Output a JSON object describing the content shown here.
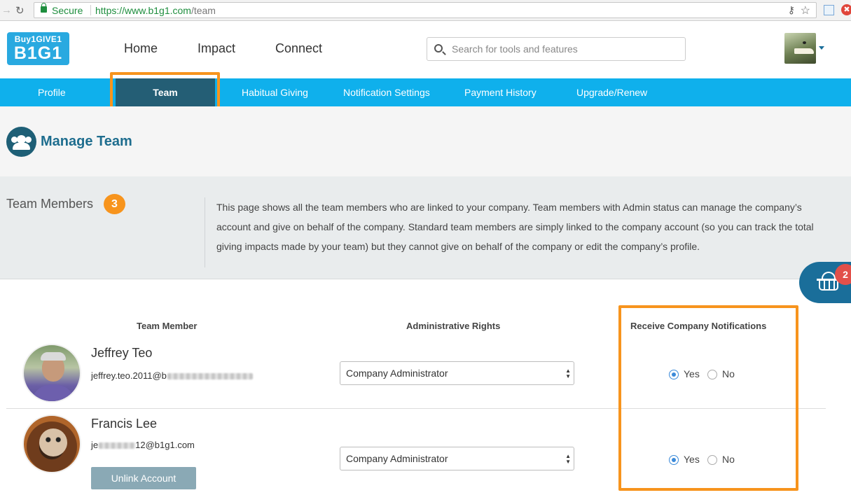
{
  "browser": {
    "secure_label": "Secure",
    "url_host": "https://www.b1g1.com",
    "url_path": "/team",
    "extension_badge": "✖"
  },
  "header": {
    "logo_line1": "Buy1GIVE1",
    "logo_line2": "B1G1",
    "nav": [
      "Home",
      "Impact",
      "Connect"
    ],
    "search_placeholder": "Search for tools and features"
  },
  "subnav": {
    "items": [
      "Profile",
      "Team",
      "Habitual Giving",
      "Notification Settings",
      "Payment History",
      "Upgrade/Renew"
    ],
    "active": "Team"
  },
  "page": {
    "title": "Manage Team",
    "members_label": "Team Members",
    "members_count": "3",
    "description": "This page shows all the team members who are linked to your company. Team members with Admin status can manage the company’s account and give on behalf of the company. Standard team members are simply linked to the company account (so you can track the total giving impacts made by your team) but they cannot give on behalf of the company or edit the company’s profile."
  },
  "cart": {
    "count": "2"
  },
  "table": {
    "headers": {
      "member": "Team Member",
      "rights": "Administrative Rights",
      "notifications": "Receive Company Notifications"
    },
    "rows": [
      {
        "name": "Jeffrey Teo",
        "email_visible_start": "jeffrey.teo.2011@b",
        "email_visible_end": "",
        "rights": "Company Administrator",
        "notify_yes": "Yes",
        "notify_no": "No",
        "notify_selected": "Yes"
      },
      {
        "name": "Francis Lee",
        "email_visible_start": "je",
        "email_visible_end": "12@b1g1.com",
        "rights": "Company Administrator",
        "notify_yes": "Yes",
        "notify_no": "No",
        "notify_selected": "Yes",
        "unlink_label": "Unlink Account"
      }
    ]
  },
  "colors": {
    "subnav_bg": "#0fb0ec",
    "subnav_active": "#245e75",
    "highlight_orange": "#f7941d",
    "brand_dark": "#1a6e9a"
  }
}
